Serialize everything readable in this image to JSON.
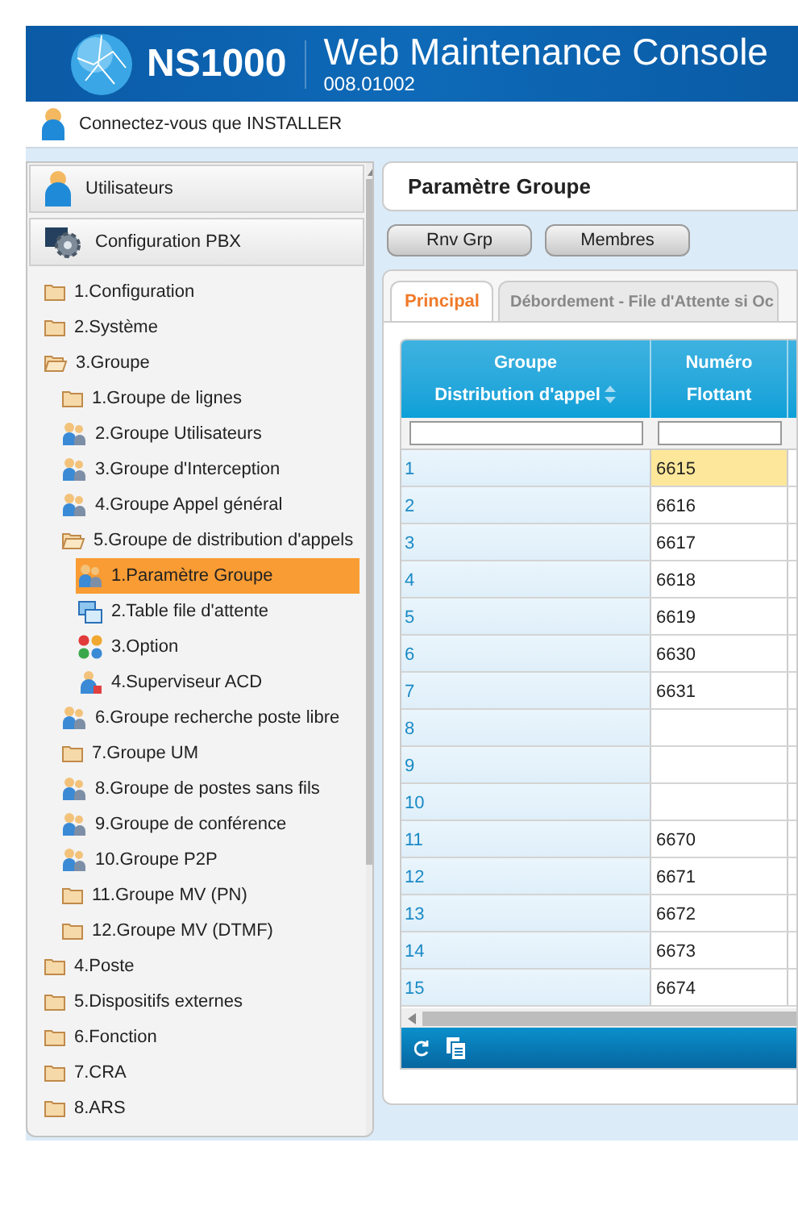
{
  "header": {
    "product": "NS1000",
    "title": "Web Maintenance Console",
    "version": "008.01002"
  },
  "login_bar": {
    "text": "Connectez-vous que INSTALLER"
  },
  "sidebar": {
    "sections": [
      {
        "label": "Utilisateurs",
        "kind": "user"
      },
      {
        "label": "Configuration PBX",
        "kind": "gear"
      }
    ],
    "tree": [
      {
        "label": "1.Configuration",
        "kind": "folder",
        "selected": false
      },
      {
        "label": "2.Système",
        "kind": "folder",
        "selected": false
      },
      {
        "label": "3.Groupe",
        "kind": "folder-open",
        "selected": false,
        "children": [
          {
            "label": "1.Groupe de lignes",
            "kind": "folder",
            "selected": false
          },
          {
            "label": "2.Groupe Utilisateurs",
            "kind": "users",
            "selected": false
          },
          {
            "label": "3.Groupe d'Interception",
            "kind": "users",
            "selected": false
          },
          {
            "label": "4.Groupe Appel général",
            "kind": "users",
            "selected": false
          },
          {
            "label": "5.Groupe de distribution d'appels",
            "kind": "folder-open",
            "selected": false,
            "children": [
              {
                "label": "1.Paramètre Groupe",
                "kind": "users",
                "selected": true
              },
              {
                "label": "2.Table file d'attente",
                "kind": "table",
                "selected": false
              },
              {
                "label": "3.Option",
                "kind": "option",
                "selected": false
              },
              {
                "label": "4.Superviseur ACD",
                "kind": "user",
                "selected": false
              }
            ]
          },
          {
            "label": "6.Groupe recherche poste libre",
            "kind": "users",
            "selected": false
          },
          {
            "label": "7.Groupe UM",
            "kind": "folder",
            "selected": false
          },
          {
            "label": "8.Groupe de postes sans fils",
            "kind": "users",
            "selected": false
          },
          {
            "label": "9.Groupe de conférence",
            "kind": "users",
            "selected": false
          },
          {
            "label": "10.Groupe P2P",
            "kind": "users",
            "selected": false
          },
          {
            "label": "11.Groupe MV (PN)",
            "kind": "folder",
            "selected": false
          },
          {
            "label": "12.Groupe MV (DTMF)",
            "kind": "folder",
            "selected": false
          }
        ]
      },
      {
        "label": "4.Poste",
        "kind": "folder",
        "selected": false
      },
      {
        "label": "5.Dispositifs externes",
        "kind": "folder",
        "selected": false
      },
      {
        "label": "6.Fonction",
        "kind": "folder",
        "selected": false
      },
      {
        "label": "7.CRA",
        "kind": "folder",
        "selected": false
      },
      {
        "label": "8.ARS",
        "kind": "folder",
        "selected": false
      }
    ]
  },
  "panel": {
    "title": "Paramètre Groupe",
    "buttons": [
      "Rnv Grp",
      "Membres"
    ],
    "tabs": [
      {
        "label": "Principal",
        "selected": true
      },
      {
        "label": "Débordement - File d'Attente si Oc",
        "selected": false
      }
    ],
    "table": {
      "columns": [
        {
          "lines": [
            "Groupe",
            "Distribution d'appel"
          ],
          "sortable": true
        },
        {
          "lines": [
            "Numéro",
            "Flottant"
          ],
          "sortable": false
        }
      ],
      "rows": [
        {
          "group": "1",
          "number": "6615",
          "highlighted": true
        },
        {
          "group": "2",
          "number": "6616",
          "highlighted": false
        },
        {
          "group": "3",
          "number": "6617",
          "highlighted": false
        },
        {
          "group": "4",
          "number": "6618",
          "highlighted": false
        },
        {
          "group": "5",
          "number": "6619",
          "highlighted": false
        },
        {
          "group": "6",
          "number": "6630",
          "highlighted": false
        },
        {
          "group": "7",
          "number": "6631",
          "highlighted": false
        },
        {
          "group": "8",
          "highlighted": false
        },
        {
          "group": "9",
          "highlighted": false
        },
        {
          "group": "10",
          "highlighted": false
        },
        {
          "group": "11",
          "number": "6670",
          "highlighted": false
        },
        {
          "group": "12",
          "number": "6671",
          "highlighted": false
        },
        {
          "group": "13",
          "number": "6672",
          "highlighted": false
        },
        {
          "group": "14",
          "number": "6673",
          "highlighted": false
        },
        {
          "group": "15",
          "number": "6674",
          "highlighted": false
        }
      ]
    }
  }
}
